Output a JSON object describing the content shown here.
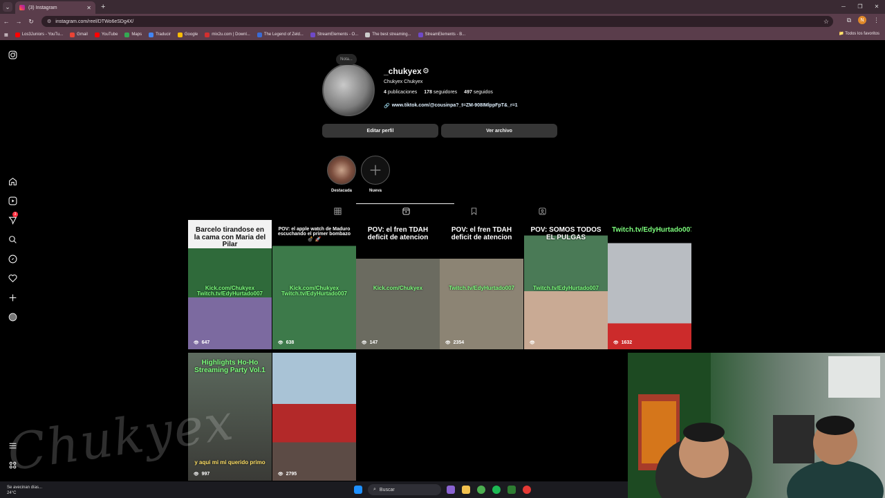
{
  "browser": {
    "tab_title": "(3) Instagram",
    "url": "instagram.com/reel/DTWo6eSDg4X/",
    "bookmarks": [
      {
        "label": "Los3Juniors - YouTu...",
        "color": "#ff0000"
      },
      {
        "label": "Gmail",
        "color": "#ea4335"
      },
      {
        "label": "YouTube",
        "color": "#ff0000"
      },
      {
        "label": "Maps",
        "color": "#34a853"
      },
      {
        "label": "Traducir",
        "color": "#4285f4"
      },
      {
        "label": "Google",
        "color": "#fbbc05"
      },
      {
        "label": "mix2u.com | Downl...",
        "color": "#d32f2f"
      },
      {
        "label": "The Legend of Zeld...",
        "color": "#3a6bd6"
      },
      {
        "label": "StreamElements - O...",
        "color": "#6f49c7"
      },
      {
        "label": "The best streaming...",
        "color": "#cccccc"
      },
      {
        "label": "StreamElements - B...",
        "color": "#6f49c7"
      }
    ],
    "all_bookmarks_label": "Todos los favoritos"
  },
  "profile": {
    "note": "Nota...",
    "username": "_chukyex",
    "full_name": "Chukyex Chukyex",
    "posts_count": "4",
    "posts_label": "publicaciones",
    "followers_count": "178",
    "followers_label": "seguidores",
    "following_count": "497",
    "following_label": "seguidos",
    "link": "www.tiktok.com/@cousinpa?_t=ZM-908IMlppFpT&_r=1",
    "edit_label": "Editar perfil",
    "archive_label": "Ver archivo"
  },
  "highlights": [
    {
      "label": "Destacada"
    },
    {
      "label": "Nueva"
    }
  ],
  "reels": [
    {
      "caption": "Barcelo tirandose en la cama con Maria del Pilar",
      "overlay": "Kick.com/Chukyex\nTwitch.tv/EdyHurtado007",
      "views": "647"
    },
    {
      "caption": "POV: el apple watch de Maduro escuchando el primer bombazo 💣 🚀",
      "overlay": "Kick.com/Chukyex\nTwitch.tv/EdyHurtado007",
      "views": "638"
    },
    {
      "caption": "POV: el fren TDAH deficit de atencion",
      "overlay": "Kick.com/Chukyex",
      "views": "147"
    },
    {
      "caption": "POV: el fren TDAH deficit de atencion",
      "overlay": "Twitch.tv/EdyHurtado007",
      "views": "2354"
    },
    {
      "caption": "POV: SOMOS TODOS EL PULGAS",
      "overlay": "Twitch.tv/EdyHurtado007",
      "views": ""
    },
    {
      "caption": "Twitch.tv/EdyHurtado007",
      "overlay": "",
      "views": "1632"
    },
    {
      "caption": "Highlights Ho-Ho Streaming Party Vol.1",
      "overlay": "y aqui mi mi querido primo",
      "views": "997"
    },
    {
      "caption": "",
      "overlay": "",
      "views": "2795"
    }
  ],
  "taskbar": {
    "weather_line1": "Se avecinan días...",
    "weather_line2": "24°C",
    "search_label": "Buscar"
  },
  "watermark": "Chukyex",
  "colors": {
    "background": "#000000",
    "chrome": "#5a3d4b",
    "button": "#363636",
    "accent_link": "#e0f1ff"
  }
}
